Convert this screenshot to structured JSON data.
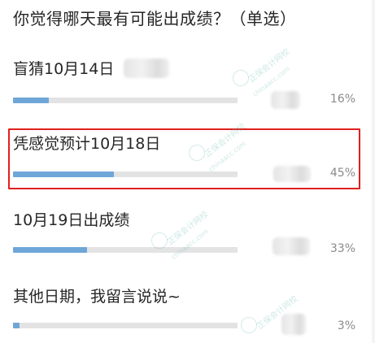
{
  "poll": {
    "title": "你觉得哪天最有可能出成绩？（单选）",
    "options": [
      {
        "label": "盲猜10月14日",
        "percent_text": "16%",
        "fraction": 0.16,
        "highlighted": false
      },
      {
        "label": "凭感觉预计10月18日",
        "percent_text": "45%",
        "fraction": 0.45,
        "highlighted": true
      },
      {
        "label": "10月19日出成绩",
        "percent_text": "33%",
        "fraction": 0.33,
        "highlighted": false
      },
      {
        "label": "其他日期，我留言说说~",
        "percent_text": "3%",
        "fraction": 0.03,
        "highlighted": false
      }
    ]
  },
  "colors": {
    "bar_fill": "#6fa6d8",
    "bar_track": "#e3e3e3",
    "highlight_border": "#e0201e",
    "percent_text": "#8a8a8a"
  },
  "watermark": {
    "text": "正保会计网校",
    "url_text": "chinaacc.com"
  }
}
